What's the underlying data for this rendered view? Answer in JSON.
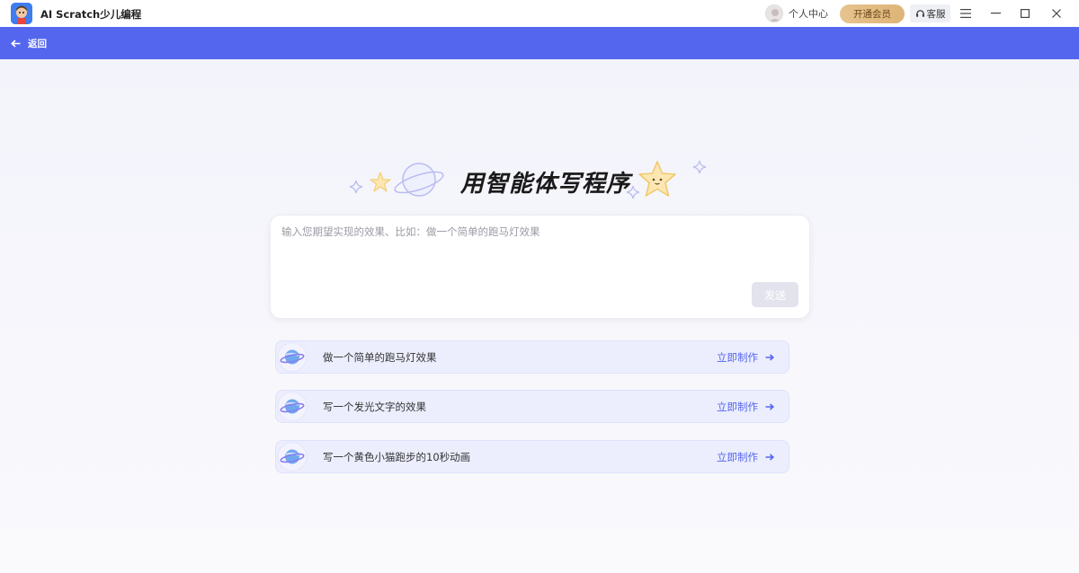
{
  "app": {
    "title": "AI Scratch少儿编程"
  },
  "titlebar": {
    "user_center_label": "个人中心",
    "vip_label": "开通会员",
    "service_label": "客服"
  },
  "nav": {
    "back_label": "返回"
  },
  "hero": {
    "title": "用智能体写程序"
  },
  "prompt": {
    "placeholder": "输入您期望实现的效果、比如：做一个简单的跑马灯效果",
    "value": "",
    "send_label": "发送"
  },
  "suggestions": [
    {
      "text": "做一个简单的跑马灯效果",
      "action": "立即制作"
    },
    {
      "text": "写一个发光文字的效果",
      "action": "立即制作"
    },
    {
      "text": "写一个黄色小猫跑步的10秒动画",
      "action": "立即制作"
    }
  ],
  "colors": {
    "accent": "#5566ee",
    "vip": "#e3bd85",
    "suggestion_bg": "#eceefe",
    "send_disabled": "#e3e3ed"
  },
  "icons": {
    "app_logo": "app-logo-icon",
    "avatar": "avatar-icon",
    "headset": "headset-icon",
    "menu": "menu-icon",
    "minimize": "minimize-icon",
    "maximize": "maximize-icon",
    "close": "close-icon",
    "back": "arrow-left-icon",
    "planet": "planet-icon",
    "arrow_right": "arrow-right-icon"
  }
}
